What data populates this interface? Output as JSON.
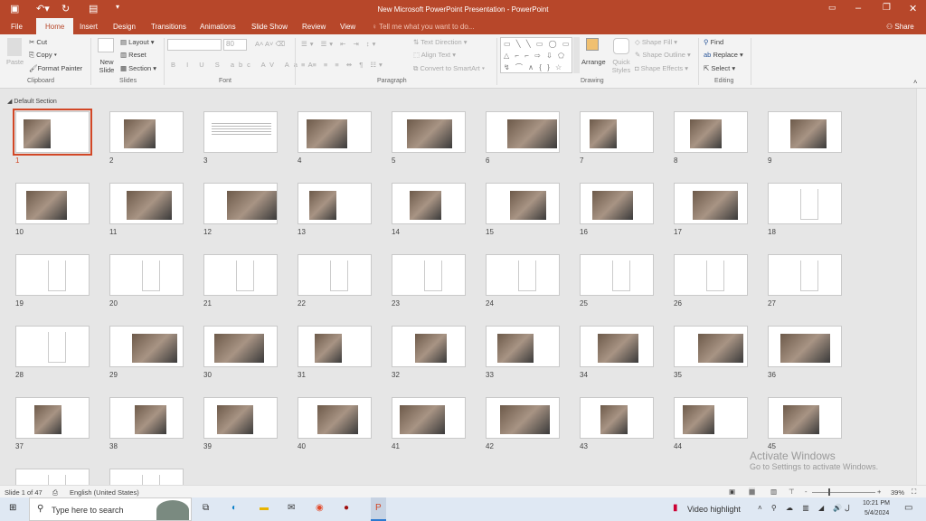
{
  "window": {
    "title": "New Microsoft PowerPoint Presentation - PowerPoint",
    "share": "Share"
  },
  "tabs": [
    "File",
    "Home",
    "Insert",
    "Design",
    "Transitions",
    "Animations",
    "Slide Show",
    "Review",
    "View"
  ],
  "tell_me": "Tell me what you want to do...",
  "ribbon": {
    "clipboard": {
      "paste": "Paste",
      "cut": "Cut",
      "copy": "Copy",
      "format_painter": "Format Painter",
      "label": "Clipboard"
    },
    "slides": {
      "new_slide": "New Slide",
      "layout": "Layout",
      "reset": "Reset",
      "section": "Section",
      "label": "Slides"
    },
    "font": {
      "font_name": "",
      "font_size": "80",
      "label": "Font"
    },
    "paragraph": {
      "text_direction": "Text Direction",
      "align_text": "Align Text",
      "convert": "Convert to SmartArt",
      "label": "Paragraph"
    },
    "drawing": {
      "arrange": "Arrange",
      "quick_styles": "Quick Styles",
      "shape_fill": "Shape Fill",
      "shape_outline": "Shape Outline",
      "shape_effects": "Shape Effects",
      "label": "Drawing"
    },
    "editing": {
      "find": "Find",
      "replace": "Replace",
      "select": "Select",
      "label": "Editing"
    }
  },
  "section_name": "Default Section",
  "slide_count": 47,
  "selected_slide": 1,
  "watermark": {
    "line1": "Activate Windows",
    "line2": "Go to Settings to activate Windows."
  },
  "status": {
    "slide": "Slide 1 of 47",
    "language": "English (United States)",
    "zoom": "39%",
    "zoom_level": 39
  },
  "taskbar": {
    "search": "Type here to search",
    "video": "Video highlight",
    "time": "10:21 PM",
    "date": "5/4/2024",
    "lang": "ل"
  }
}
